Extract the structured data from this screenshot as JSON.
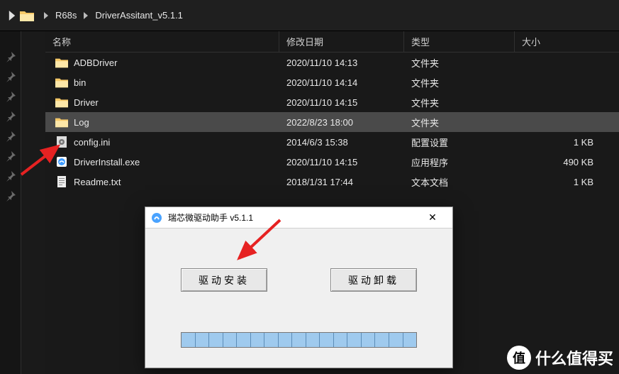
{
  "breadcrumb": {
    "items": [
      "R68s",
      "DriverAssitant_v5.1.1"
    ]
  },
  "columns": {
    "name": "名称",
    "date": "修改日期",
    "type": "类型",
    "size": "大小"
  },
  "rows": [
    {
      "icon": "folder",
      "name": "ADBDriver",
      "date": "2020/11/10 14:13",
      "type": "文件夹",
      "size": "",
      "selected": false
    },
    {
      "icon": "folder",
      "name": "bin",
      "date": "2020/11/10 14:14",
      "type": "文件夹",
      "size": "",
      "selected": false
    },
    {
      "icon": "folder",
      "name": "Driver",
      "date": "2020/11/10 14:15",
      "type": "文件夹",
      "size": "",
      "selected": false
    },
    {
      "icon": "folder-open",
      "name": "Log",
      "date": "2022/8/23 18:00",
      "type": "文件夹",
      "size": "",
      "selected": true
    },
    {
      "icon": "ini",
      "name": "config.ini",
      "date": "2014/6/3 15:38",
      "type": "配置设置",
      "size": "1 KB",
      "selected": false
    },
    {
      "icon": "exe",
      "name": "DriverInstall.exe",
      "date": "2020/11/10 14:15",
      "type": "应用程序",
      "size": "490 KB",
      "selected": false
    },
    {
      "icon": "txt",
      "name": "Readme.txt",
      "date": "2018/1/31 17:44",
      "type": "文本文档",
      "size": "1 KB",
      "selected": false
    }
  ],
  "dialog": {
    "title": "瑞芯微驱动助手 v5.1.1",
    "install": "驱动安装",
    "uninstall": "驱动卸载"
  },
  "watermark": {
    "badge": "值",
    "text": "什么值得买"
  }
}
